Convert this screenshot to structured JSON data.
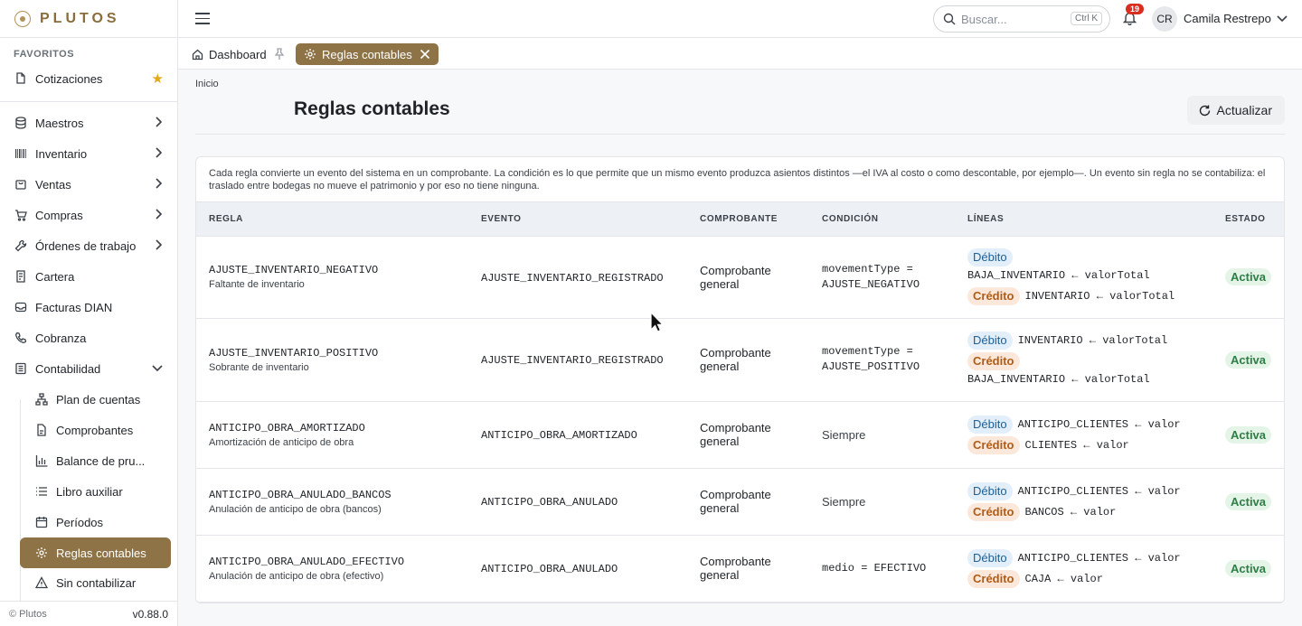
{
  "brand": {
    "name": "PLUTOS"
  },
  "sidebar": {
    "favorites_label": "FAVORITOS",
    "favorites": [
      {
        "label": "Cotizaciones",
        "icon": "file-edit-icon"
      }
    ],
    "items": [
      {
        "label": "Maestros",
        "icon": "database-icon"
      },
      {
        "label": "Inventario",
        "icon": "barcode-icon"
      },
      {
        "label": "Ventas",
        "icon": "shopping-bag-icon"
      },
      {
        "label": "Compras",
        "icon": "cart-icon"
      },
      {
        "label": "Órdenes de trabajo",
        "icon": "wrench-icon"
      },
      {
        "label": "Cartera",
        "icon": "receipt-icon"
      },
      {
        "label": "Facturas DIAN",
        "icon": "inbox-icon"
      },
      {
        "label": "Cobranza",
        "icon": "phone-icon"
      },
      {
        "label": "Contabilidad",
        "icon": "book-icon"
      }
    ],
    "sub_items": [
      {
        "label": "Plan de cuentas",
        "icon": "hierarchy-icon"
      },
      {
        "label": "Comprobantes",
        "icon": "document-icon"
      },
      {
        "label": "Balance de pru...",
        "icon": "bar-chart-icon"
      },
      {
        "label": "Libro auxiliar",
        "icon": "list-icon"
      },
      {
        "label": "Períodos",
        "icon": "calendar-icon"
      },
      {
        "label": "Reglas contables",
        "icon": "gear-icon"
      },
      {
        "label": "Sin contabilizar",
        "icon": "warning-icon"
      }
    ],
    "footer_left": "© Plutos",
    "footer_version": "v0.88.0"
  },
  "topbar": {
    "search_placeholder": "Buscar...",
    "search_shortcut": "Ctrl K",
    "notification_count": "19",
    "avatar_initials": "CR",
    "username": "Camila Restrepo"
  },
  "tabs": [
    {
      "label": "Dashboard"
    },
    {
      "label": "Reglas contables"
    }
  ],
  "main": {
    "breadcrumb": "Inicio",
    "title": "Reglas contables",
    "refresh_label": "Actualizar",
    "description": "Cada regla convierte un evento del sistema en un comprobante. La condición es lo que permite que un mismo evento produzca asientos distintos —el IVA al costo o como descontable, por ejemplo—. Un evento sin regla no se contabiliza: el traslado entre bodegas no mueve el patrimonio y por eso no tiene ninguna."
  },
  "table": {
    "headers": [
      "REGLA",
      "EVENTO",
      "COMPROBANTE",
      "CONDICIÓN",
      "LÍNEAS",
      "ESTADO"
    ],
    "rows": [
      {
        "code": "AJUSTE_INVENTARIO_NEGATIVO",
        "desc": "Faltante de inventario",
        "evento": "AJUSTE_INVENTARIO_REGISTRADO",
        "comprobante": "Comprobante general",
        "condicion": "movementType = AJUSTE_NEGATIVO",
        "cond_plain": false,
        "lineas": [
          {
            "tipo": "Débito",
            "texto": "BAJA_INVENTARIO ← valorTotal"
          },
          {
            "tipo": "Crédito",
            "texto": "INVENTARIO ← valorTotal"
          }
        ],
        "estado": "Activa"
      },
      {
        "code": "AJUSTE_INVENTARIO_POSITIVO",
        "desc": "Sobrante de inventario",
        "evento": "AJUSTE_INVENTARIO_REGISTRADO",
        "comprobante": "Comprobante general",
        "condicion": "movementType = AJUSTE_POSITIVO",
        "cond_plain": false,
        "lineas": [
          {
            "tipo": "Débito",
            "texto": "INVENTARIO ← valorTotal"
          },
          {
            "tipo": "Crédito",
            "texto": "BAJA_INVENTARIO ← valorTotal"
          }
        ],
        "estado": "Activa"
      },
      {
        "code": "ANTICIPO_OBRA_AMORTIZADO",
        "desc": "Amortización de anticipo de obra",
        "evento": "ANTICIPO_OBRA_AMORTIZADO",
        "comprobante": "Comprobante general",
        "condicion": "Siempre",
        "cond_plain": true,
        "lineas": [
          {
            "tipo": "Débito",
            "texto": "ANTICIPO_CLIENTES ← valor"
          },
          {
            "tipo": "Crédito",
            "texto": "CLIENTES ← valor"
          }
        ],
        "estado": "Activa"
      },
      {
        "code": "ANTICIPO_OBRA_ANULADO_BANCOS",
        "desc": "Anulación de anticipo de obra (bancos)",
        "evento": "ANTICIPO_OBRA_ANULADO",
        "comprobante": "Comprobante general",
        "condicion": "Siempre",
        "cond_plain": true,
        "lineas": [
          {
            "tipo": "Débito",
            "texto": "ANTICIPO_CLIENTES ← valor"
          },
          {
            "tipo": "Crédito",
            "texto": "BANCOS ← valor"
          }
        ],
        "estado": "Activa"
      },
      {
        "code": "ANTICIPO_OBRA_ANULADO_EFECTIVO",
        "desc": "Anulación de anticipo de obra (efectivo)",
        "evento": "ANTICIPO_OBRA_ANULADO",
        "comprobante": "Comprobante general",
        "condicion": "medio = EFECTIVO",
        "cond_plain": false,
        "lineas": [
          {
            "tipo": "Débito",
            "texto": "ANTICIPO_CLIENTES ← valor"
          },
          {
            "tipo": "Crédito",
            "texto": "CAJA ← valor"
          }
        ],
        "estado": "Activa"
      }
    ]
  },
  "colors": {
    "accent": "#8d7346",
    "debit_bg": "#e2effa",
    "credit_bg": "#fbe8da",
    "active_bg": "#e4f5e8"
  }
}
